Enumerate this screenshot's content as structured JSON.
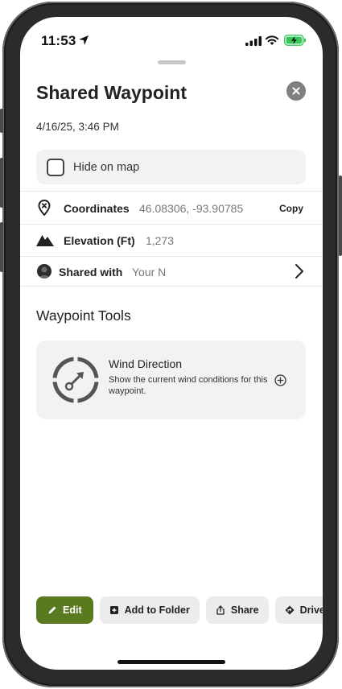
{
  "status_bar": {
    "time": "11:53"
  },
  "sheet": {
    "title": "Shared Waypoint",
    "datetime": "4/16/25, 3:46 PM",
    "hide_on_map_label": "Hide on map"
  },
  "details": {
    "coordinates": {
      "label": "Coordinates",
      "value": "46.08306, -93.90785",
      "copy_label": "Copy"
    },
    "elevation": {
      "label": "Elevation (Ft)",
      "value": "1,273"
    },
    "shared_with": {
      "label": "Shared with",
      "value": "Your N"
    }
  },
  "tools": {
    "section_title": "Waypoint Tools",
    "items": [
      {
        "title": "Wind Direction",
        "description": "Show the current wind conditions for this waypoint.",
        "icon": "compass-icon"
      }
    ]
  },
  "actions": [
    {
      "label": "Edit",
      "icon": "pencil-icon"
    },
    {
      "label": "Add to Folder",
      "icon": "folder-plus-icon"
    },
    {
      "label": "Share",
      "icon": "share-icon"
    },
    {
      "label": "Drive",
      "icon": "directions-icon"
    }
  ],
  "colors": {
    "primary_green": "#5a7a1f",
    "card_background": "#f2f2f2",
    "close_button": "#808080"
  }
}
